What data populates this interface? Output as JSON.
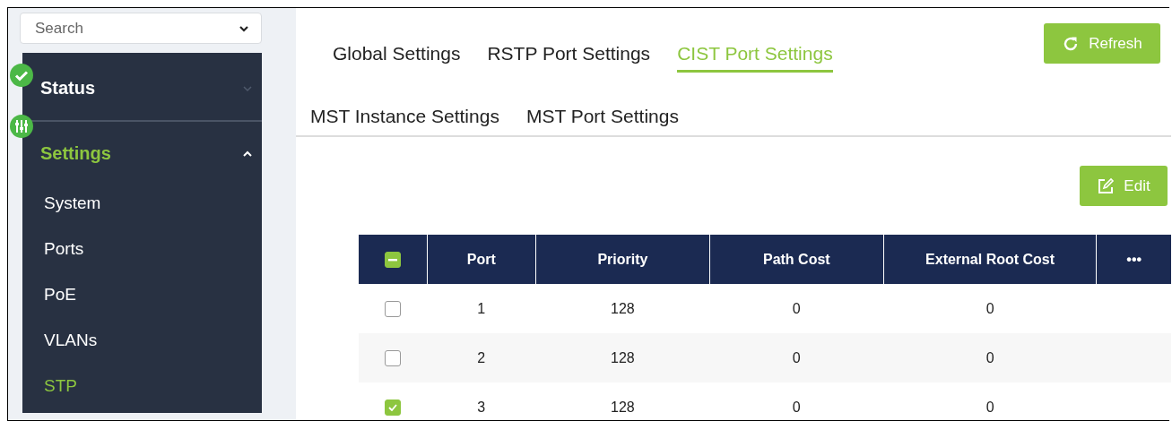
{
  "sidebar": {
    "search": {
      "placeholder": "Search"
    },
    "sections": [
      {
        "kind": "status",
        "label": "Status",
        "expanded": false,
        "selected": false
      },
      {
        "kind": "settings",
        "label": "Settings",
        "expanded": true,
        "selected": true,
        "children": [
          {
            "label": "System",
            "selected": false
          },
          {
            "label": "Ports",
            "selected": false
          },
          {
            "label": "PoE",
            "selected": false
          },
          {
            "label": "VLANs",
            "selected": false
          },
          {
            "label": "STP",
            "selected": true
          }
        ]
      }
    ]
  },
  "tabs": [
    {
      "label": "Global Settings",
      "selected": false
    },
    {
      "label": "RSTP Port Settings",
      "selected": false
    },
    {
      "label": "CIST Port Settings",
      "selected": true
    },
    {
      "label": "MST Instance Settings",
      "selected": false
    },
    {
      "label": "MST Port Settings",
      "selected": false
    }
  ],
  "buttons": {
    "refresh": "Refresh",
    "edit": "Edit"
  },
  "table": {
    "select_all": {
      "indeterminate": true
    },
    "columns": [
      "Port",
      "Priority",
      "Path Cost",
      "External Root Cost",
      "•••"
    ],
    "rows": [
      {
        "checked": false,
        "cells": [
          "1",
          "128",
          "0",
          "0"
        ]
      },
      {
        "checked": false,
        "cells": [
          "2",
          "128",
          "0",
          "0"
        ]
      },
      {
        "checked": true,
        "cells": [
          "3",
          "128",
          "0",
          "0"
        ]
      }
    ]
  }
}
